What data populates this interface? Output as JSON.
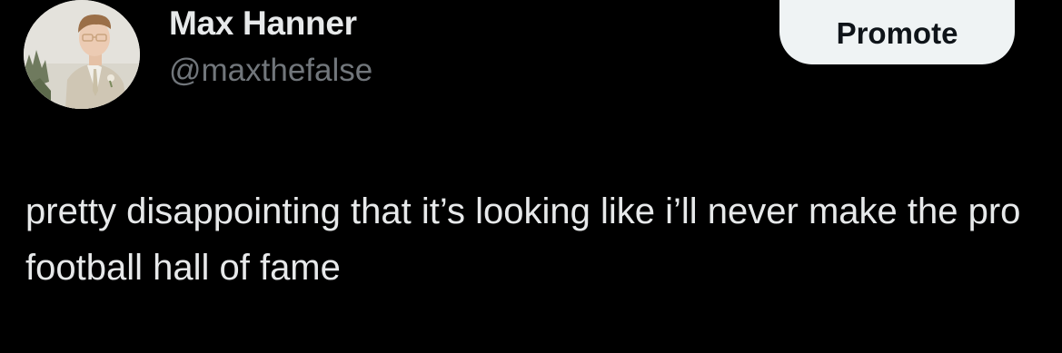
{
  "tweet": {
    "author": {
      "display_name": "Max Hanner",
      "handle": "@maxthefalse",
      "avatar_icon": "profile-photo"
    },
    "promote_label": "Promote",
    "text": "pretty disappointing that it’s looking like i’ll never make the pro football hall of fame"
  },
  "colors": {
    "background": "#000000",
    "primary_text": "#e7e9ea",
    "secondary_text": "#71767b",
    "button_bg": "#eff3f4",
    "button_text": "#0f1419"
  }
}
